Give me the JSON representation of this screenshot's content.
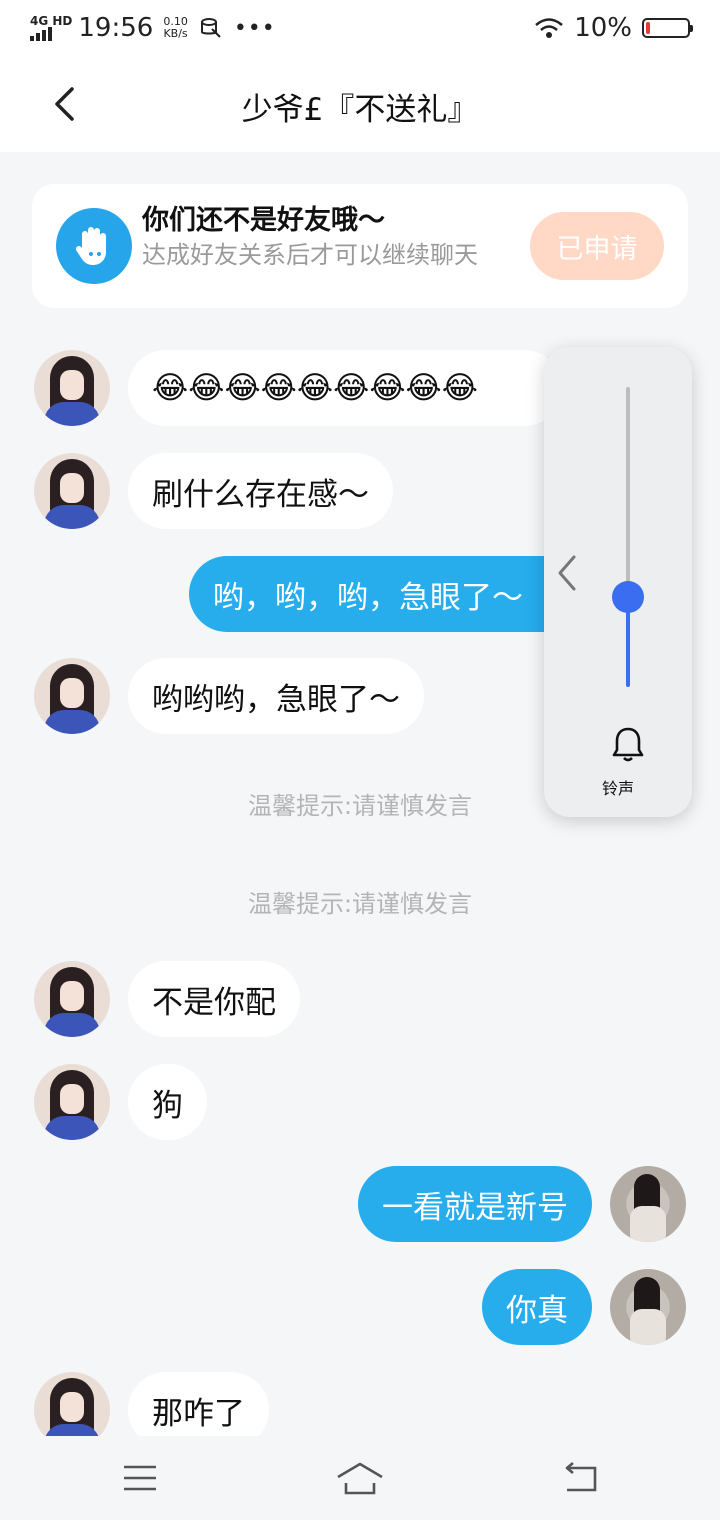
{
  "status_bar": {
    "network": "4G HD",
    "time": "19:56",
    "speed_value": "0.10",
    "speed_unit": "KB/s",
    "more": "•••",
    "battery": "10%",
    "battery_level": 0.1,
    "battery_color": "#e53935"
  },
  "header": {
    "title": "少爷£『不送礼』"
  },
  "friend_card": {
    "title": "你们还不是好友哦～",
    "subtitle": "达成好友关系后才可以继续聊天",
    "button": "已申请"
  },
  "messages": [
    {
      "side": "in",
      "text": "😂😂😂😂😂😂😂😂😂"
    },
    {
      "side": "in",
      "text": "刷什么存在感～"
    },
    {
      "side": "out",
      "text": "哟，哟，哟，急眼了～"
    },
    {
      "side": "in",
      "text": "哟哟哟，急眼了～"
    },
    {
      "side": "system",
      "text": "温馨提示:请谨慎发言"
    },
    {
      "side": "system",
      "text": "温馨提示:请谨慎发言"
    },
    {
      "side": "in",
      "text": "不是你配"
    },
    {
      "side": "in",
      "text": "狗"
    },
    {
      "side": "out",
      "text": "一看就是新号"
    },
    {
      "side": "out",
      "text": "你真"
    },
    {
      "side": "in",
      "text": "那咋了"
    }
  ],
  "volume_panel": {
    "label": "铃声",
    "level": 0.3,
    "accent": "#3a6df0"
  },
  "colors": {
    "outgoing_bubble": "#27acec",
    "applied_button": "#ffd8c6",
    "hand_icon_bg": "#27a5ea"
  },
  "icons": {
    "back": "chevron-left-icon",
    "friend": "hand-wave-icon",
    "volume_collapse": "chevron-left-icon",
    "ringer": "bell-icon",
    "nav_menu": "menu-icon",
    "nav_home": "home-icon",
    "nav_back": "return-icon"
  }
}
